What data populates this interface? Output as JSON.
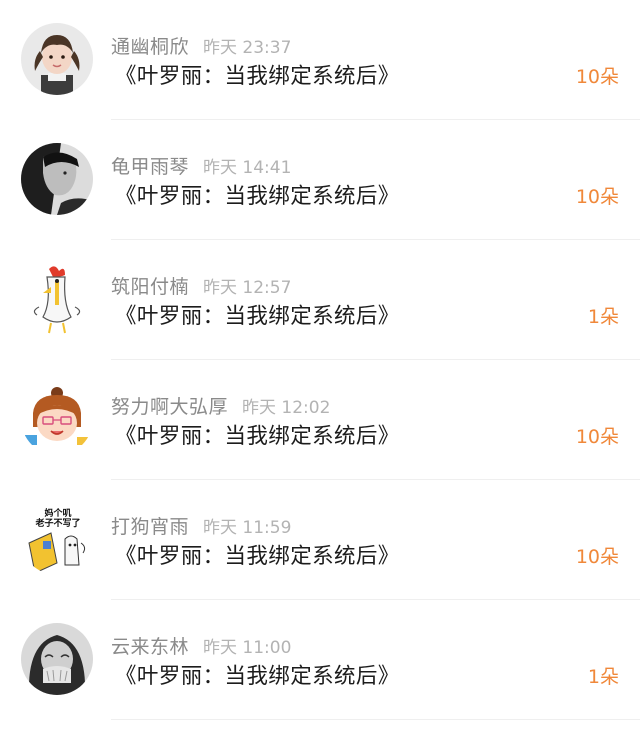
{
  "colors": {
    "name": "#8a8a8a",
    "time": "#b3b3b3",
    "gift_text": "#1c1c1c",
    "count": "#f0883a"
  },
  "rows": [
    {
      "name": "通幽桐欣",
      "time": "昨天 23:37",
      "gift": "《叶罗丽：当我绑定系统后》",
      "count": "10朵",
      "avatar_icon": "girl-with-pigtails-avatar-icon"
    },
    {
      "name": "龟甲雨琴",
      "time": "昨天 14:41",
      "gift": "《叶罗丽：当我绑定系统后》",
      "count": "10朵",
      "avatar_icon": "monochrome-portrait-avatar-icon"
    },
    {
      "name": "筑阳付楠",
      "time": "昨天 12:57",
      "gift": "《叶罗丽：当我绑定系统后》",
      "count": "1朵",
      "avatar_icon": "cartoon-chicken-avatar-icon"
    },
    {
      "name": "努力啊大弘厚",
      "time": "昨天 12:02",
      "gift": "《叶罗丽：当我绑定系统后》",
      "count": "10朵",
      "avatar_icon": "cartoon-girl-avatar-icon"
    },
    {
      "name": "打狗宵雨",
      "time": "昨天 11:59",
      "gift": "《叶罗丽：当我绑定系统后》",
      "count": "10朵",
      "avatar_icon": "meme-sticker-avatar-icon",
      "avatar_text": "妈个叽 老子不写了"
    },
    {
      "name": "云来东林",
      "time": "昨天 11:00",
      "gift": "《叶罗丽：当我绑定系统后》",
      "count": "1朵",
      "avatar_icon": "laughing-woman-avatar-icon"
    }
  ]
}
